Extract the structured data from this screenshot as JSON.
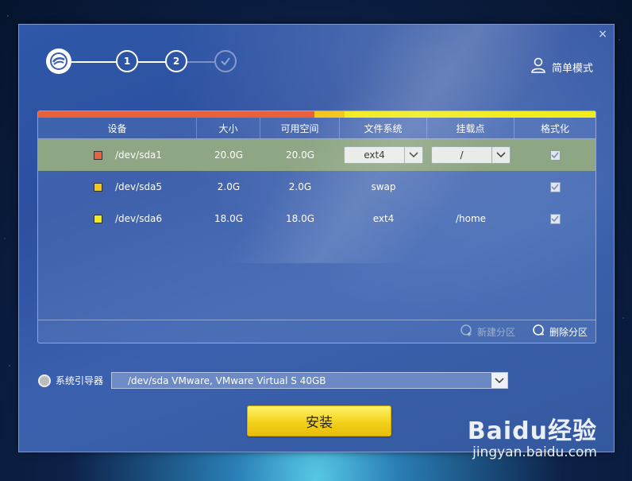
{
  "window": {
    "close_label": "×"
  },
  "stepper": {
    "steps": [
      "1",
      "2"
    ],
    "logo_icon": "deepin-logo-icon",
    "done_icon": "check-circle-icon"
  },
  "header": {
    "simple_mode_label": "简单模式",
    "simple_mode_icon": "user-icon"
  },
  "usage_bar": {
    "segments": [
      {
        "color": "#e8613a",
        "fraction": 0.496
      },
      {
        "color": "#f4c51b",
        "fraction": 0.054
      },
      {
        "color": "#f1ec1b",
        "fraction": 0.45
      }
    ]
  },
  "table": {
    "columns": [
      "设备",
      "大小",
      "可用空间",
      "文件系统",
      "挂载点",
      "格式化"
    ],
    "rows": [
      {
        "color": "#e8613a",
        "device": "/dev/sda1",
        "size": "20.0G",
        "free": "20.0G",
        "fs": "ext4",
        "mount": "/",
        "format": true,
        "selected": true
      },
      {
        "color": "#f4c51b",
        "device": "/dev/sda5",
        "size": "2.0G",
        "free": "2.0G",
        "fs": "swap",
        "mount": "",
        "format": true,
        "selected": false
      },
      {
        "color": "#f1ec1b",
        "device": "/dev/sda6",
        "size": "18.0G",
        "free": "18.0G",
        "fs": "ext4",
        "mount": "/home",
        "format": true,
        "selected": false
      }
    ]
  },
  "panel_footer": {
    "new_partition_label": "新建分区",
    "delete_partition_label": "删除分区"
  },
  "bootloader": {
    "label": "系统引导器",
    "value": "/dev/sda VMware, VMware Virtual S 40GB"
  },
  "install": {
    "label": "安装"
  },
  "watermark": {
    "logo": "Baidu经验",
    "url": "jingyan.baidu.com"
  }
}
